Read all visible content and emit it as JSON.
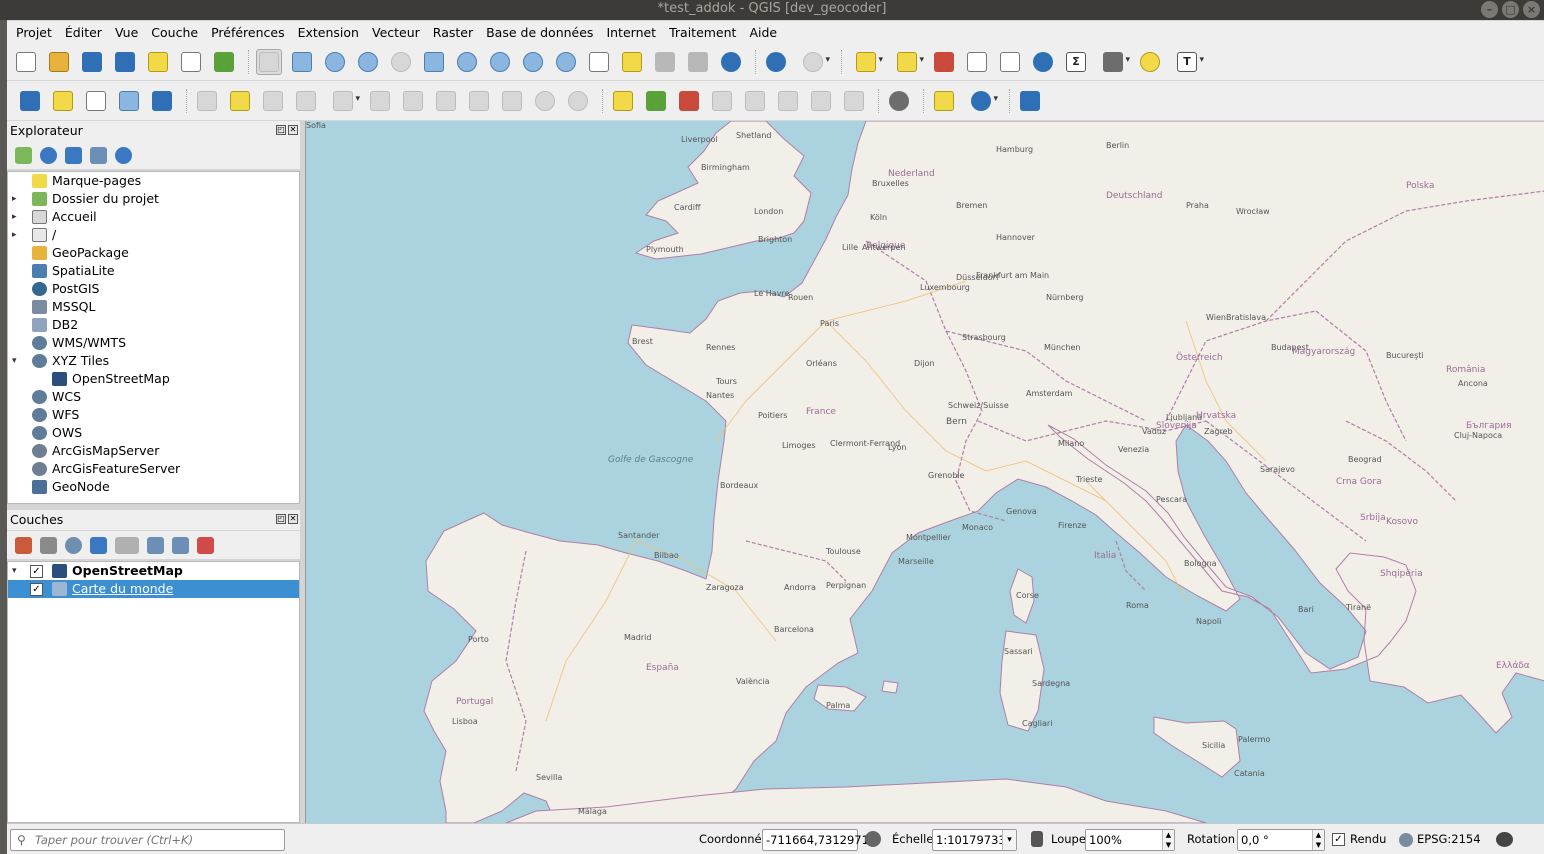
{
  "window": {
    "title": "*test_addok - QGIS [dev_geocoder]",
    "controls": [
      "–",
      "□",
      "×"
    ]
  },
  "menu": [
    "Projet",
    "Éditer",
    "Vue",
    "Couche",
    "Préférences",
    "Extension",
    "Vecteur",
    "Raster",
    "Base de données",
    "Internet",
    "Traitement",
    "Aide"
  ],
  "toolbar2": {
    "python_icon": "python-icon",
    "help_icon": "help-icon"
  },
  "explorer": {
    "title": "Explorateur",
    "items": [
      {
        "label": "Marque-pages",
        "icon": "star-icon",
        "arrow": ""
      },
      {
        "label": "Dossier du projet",
        "icon": "project-folder-icon",
        "arrow": "▸"
      },
      {
        "label": "Accueil",
        "icon": "home-folder-icon",
        "arrow": "▸"
      },
      {
        "label": "/",
        "icon": "folder-icon",
        "arrow": "▸"
      },
      {
        "label": "GeoPackage",
        "icon": "geopackage-icon",
        "arrow": ""
      },
      {
        "label": "SpatiaLite",
        "icon": "spatialite-icon",
        "arrow": ""
      },
      {
        "label": "PostGIS",
        "icon": "postgis-icon",
        "arrow": ""
      },
      {
        "label": "MSSQL",
        "icon": "mssql-icon",
        "arrow": ""
      },
      {
        "label": "DB2",
        "icon": "db2-icon",
        "arrow": ""
      },
      {
        "label": "WMS/WMTS",
        "icon": "globe-icon",
        "arrow": ""
      },
      {
        "label": "XYZ Tiles",
        "icon": "globe-icon",
        "arrow": "▾"
      },
      {
        "label": "OpenStreetMap",
        "icon": "tiles-icon",
        "arrow": ""
      },
      {
        "label": "WCS",
        "icon": "globe-icon",
        "arrow": ""
      },
      {
        "label": "WFS",
        "icon": "globe-icon",
        "arrow": ""
      },
      {
        "label": "OWS",
        "icon": "globe-icon",
        "arrow": ""
      },
      {
        "label": "ArcGisMapServer",
        "icon": "arcgis-icon",
        "arrow": ""
      },
      {
        "label": "ArcGisFeatureServer",
        "icon": "arcgis-icon",
        "arrow": ""
      },
      {
        "label": "GeoNode",
        "icon": "geonode-icon",
        "arrow": ""
      }
    ]
  },
  "layers": {
    "title": "Couches",
    "items": [
      {
        "label": "OpenStreetMap",
        "checked": "✓",
        "arrow": "▾"
      },
      {
        "label": "Carte du monde",
        "checked": "✓",
        "arrow": ""
      }
    ]
  },
  "panel_buttons": [
    "◰",
    "✕"
  ],
  "map": {
    "labels": [
      "Shetland",
      "Liverpool",
      "Birmingham",
      "Cardiff",
      "London",
      "Brighton",
      "Plymouth",
      "Lille",
      "Le Havre",
      "Rouen",
      "Paris",
      "Rennes",
      "Brest",
      "Nantes",
      "Orléans",
      "Tours",
      "Poitiers",
      "Limoges",
      "Bordeaux",
      "Clermont-Ferrand",
      "Lyon",
      "Dijon",
      "Strasbourg",
      "France",
      "Grenoble",
      "Montpellier",
      "Marseille",
      "Toulouse",
      "Monaco",
      "Genova",
      "Milano",
      "Venezia",
      "Firenze",
      "Italia",
      "Roma",
      "Napoli",
      "Bari",
      "Palermo",
      "Catania",
      "Sassari",
      "Cagliari",
      "Corse",
      "Barcelona",
      "Andorra",
      "Perpignan",
      "Zaragoza",
      "Bilbao",
      "Santander",
      "Madrid",
      "España",
      "València",
      "Palma",
      "Sevilla",
      "Málaga",
      "Lisboa",
      "Portugal",
      "Porto",
      "Nederland",
      "Belgique",
      "Luxembourg",
      "Frankfurt am Main",
      "Nürnberg",
      "München",
      "Berlin",
      "Deutschland",
      "Wien",
      "Österreich",
      "Praha",
      "Bratislava",
      "Budapest",
      "Magyarország",
      "Zagreb",
      "Hrvatska",
      "Slovenija",
      "Ljubljana",
      "Sarajevo",
      "Crna Gora",
      "Beograd",
      "Srbija",
      "Kosovo",
      "Shqipëria",
      "Tiranë",
      "Ελλάδα",
      "România",
      "България",
      "Schweiz/Suisse",
      "Bern",
      "Golfe de Gascogne",
      "Sardegna",
      "Sicilia",
      "Polska",
      "Wrocław",
      "Hamburg",
      "Bremen",
      "Hannover",
      "Düsseldorf",
      "Köln",
      "Antwerpen",
      "Bruxelles",
      "Amsterdam",
      "Vaduz",
      "Trieste",
      "Bologna",
      "Pescara",
      "Ancona",
      "Bucureşti",
      "Cluj-Napoca",
      "Sofia"
    ]
  },
  "status": {
    "search_placeholder": "Taper pour trouver (Ctrl+K)",
    "coord_label": "Coordonnée",
    "coord_value": "-711664,7312971",
    "scale_label": "Échelle",
    "scale_value": "1:10179733",
    "magnifier_label": "Loupe",
    "magnifier_value": "100%",
    "rotation_label": "Rotation",
    "rotation_value": "0,0 °",
    "render_label": "Rendu",
    "render_checked": "✓",
    "crs": "EPSG:2154"
  },
  "colors": {
    "sea": "#aad3df",
    "land": "#f2efe9",
    "border": "#b07fa6",
    "selection": "#3c8fd0"
  }
}
